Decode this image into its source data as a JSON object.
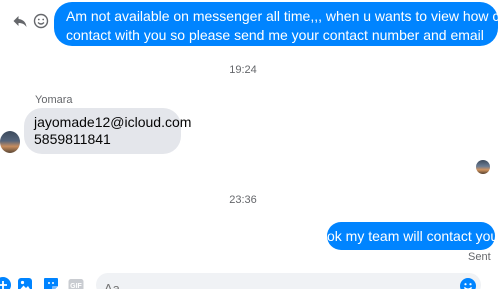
{
  "conversation": {
    "top_outgoing": {
      "line1": "Am not available on messenger all time,,, when u wants to view how can i",
      "line2": "contact with you so please send me your contact number and email"
    },
    "timestamp_1": "19:24",
    "incoming": {
      "sender_name": "Yomara",
      "line1": "jayomade12@icloud.com",
      "line2": "5859811841"
    },
    "timestamp_2": "23:36",
    "bottom_outgoing": "ok my team will contact you",
    "status": "Sent"
  },
  "composer": {
    "placeholder": "Aa"
  },
  "colors": {
    "accent": "#0084ff",
    "incoming_bubble": "#e4e6eb",
    "muted_text": "#65676b"
  },
  "icons": [
    "reply-icon",
    "emoji-icon",
    "add-icon",
    "photo-icon",
    "sticker-icon",
    "gif-icon",
    "composer-emoji-icon"
  ]
}
